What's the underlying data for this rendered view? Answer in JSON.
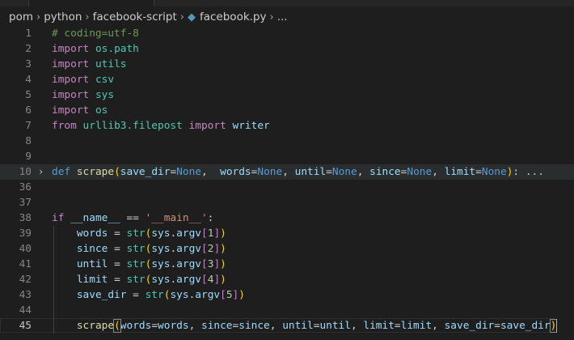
{
  "breadcrumb": {
    "items": [
      "pom",
      "python",
      "facebook-script"
    ],
    "file": "facebook.py",
    "more": "..."
  },
  "editor": {
    "lines": [
      {
        "num": "1",
        "tokens": [
          [
            "c",
            "# coding=utf-8"
          ]
        ]
      },
      {
        "num": "2",
        "tokens": [
          [
            "i",
            "import"
          ],
          [
            "e",
            " "
          ],
          [
            "m",
            "os.path"
          ]
        ]
      },
      {
        "num": "3",
        "tokens": [
          [
            "i",
            "import"
          ],
          [
            "e",
            " "
          ],
          [
            "m",
            "utils"
          ]
        ]
      },
      {
        "num": "4",
        "tokens": [
          [
            "i",
            "import"
          ],
          [
            "e",
            " "
          ],
          [
            "m",
            "csv"
          ]
        ]
      },
      {
        "num": "5",
        "tokens": [
          [
            "i",
            "import"
          ],
          [
            "e",
            " "
          ],
          [
            "m",
            "sys"
          ]
        ]
      },
      {
        "num": "6",
        "tokens": [
          [
            "i",
            "import"
          ],
          [
            "e",
            " "
          ],
          [
            "m",
            "os"
          ]
        ]
      },
      {
        "num": "7",
        "tokens": [
          [
            "i",
            "from"
          ],
          [
            "e",
            " "
          ],
          [
            "m",
            "urllib3.filepost"
          ],
          [
            "e",
            " "
          ],
          [
            "i",
            "import"
          ],
          [
            "e",
            " "
          ],
          [
            "v",
            "writer"
          ]
        ]
      },
      {
        "num": "8",
        "tokens": []
      },
      {
        "num": "9",
        "tokens": []
      },
      {
        "num": "10",
        "folded": true,
        "highlight": true,
        "tokens": [
          [
            "k",
            "def"
          ],
          [
            "e",
            " "
          ],
          [
            "f",
            "scrape"
          ],
          [
            "br",
            "("
          ],
          [
            "v",
            "save_dir"
          ],
          [
            "e",
            "="
          ],
          [
            "k",
            "None"
          ],
          [
            "e",
            ",  "
          ],
          [
            "v",
            "words"
          ],
          [
            "e",
            "="
          ],
          [
            "k",
            "None"
          ],
          [
            "e",
            ", "
          ],
          [
            "v",
            "until"
          ],
          [
            "e",
            "="
          ],
          [
            "k",
            "None"
          ],
          [
            "e",
            ", "
          ],
          [
            "v",
            "since"
          ],
          [
            "e",
            "="
          ],
          [
            "k",
            "None"
          ],
          [
            "e",
            ", "
          ],
          [
            "v",
            "limit"
          ],
          [
            "e",
            "="
          ],
          [
            "k",
            "None"
          ],
          [
            "br",
            ")"
          ],
          [
            "e",
            ":"
          ],
          [
            "ell",
            " ..."
          ]
        ]
      },
      {
        "num": "36",
        "tokens": []
      },
      {
        "num": "37",
        "tokens": []
      },
      {
        "num": "38",
        "tokens": [
          [
            "i",
            "if"
          ],
          [
            "e",
            " "
          ],
          [
            "v",
            "__name__"
          ],
          [
            "e",
            " == "
          ],
          [
            "s",
            "'__main__'"
          ],
          [
            "e",
            ":"
          ]
        ]
      },
      {
        "num": "39",
        "tokens": [
          [
            "e",
            "    "
          ],
          [
            "v",
            "words"
          ],
          [
            "e",
            " = "
          ],
          [
            "m",
            "str"
          ],
          [
            "br",
            "("
          ],
          [
            "v",
            "sys"
          ],
          [
            "e",
            "."
          ],
          [
            "v",
            "argv"
          ],
          [
            "bp",
            "["
          ],
          [
            "n",
            "1"
          ],
          [
            "bp",
            "]"
          ],
          [
            "br",
            ")"
          ]
        ]
      },
      {
        "num": "40",
        "tokens": [
          [
            "e",
            "    "
          ],
          [
            "v",
            "since"
          ],
          [
            "e",
            " = "
          ],
          [
            "m",
            "str"
          ],
          [
            "br",
            "("
          ],
          [
            "v",
            "sys"
          ],
          [
            "e",
            "."
          ],
          [
            "v",
            "argv"
          ],
          [
            "bp",
            "["
          ],
          [
            "n",
            "2"
          ],
          [
            "bp",
            "]"
          ],
          [
            "br",
            ")"
          ]
        ]
      },
      {
        "num": "41",
        "tokens": [
          [
            "e",
            "    "
          ],
          [
            "v",
            "until"
          ],
          [
            "e",
            " = "
          ],
          [
            "m",
            "str"
          ],
          [
            "br",
            "("
          ],
          [
            "v",
            "sys"
          ],
          [
            "e",
            "."
          ],
          [
            "v",
            "argv"
          ],
          [
            "bp",
            "["
          ],
          [
            "n",
            "3"
          ],
          [
            "bp",
            "]"
          ],
          [
            "br",
            ")"
          ]
        ]
      },
      {
        "num": "42",
        "tokens": [
          [
            "e",
            "    "
          ],
          [
            "v",
            "limit"
          ],
          [
            "e",
            " = "
          ],
          [
            "m",
            "str"
          ],
          [
            "br",
            "("
          ],
          [
            "v",
            "sys"
          ],
          [
            "e",
            "."
          ],
          [
            "v",
            "argv"
          ],
          [
            "bp",
            "["
          ],
          [
            "n",
            "4"
          ],
          [
            "bp",
            "]"
          ],
          [
            "br",
            ")"
          ]
        ]
      },
      {
        "num": "43",
        "tokens": [
          [
            "e",
            "    "
          ],
          [
            "v",
            "save_dir"
          ],
          [
            "e",
            " = "
          ],
          [
            "m",
            "str"
          ],
          [
            "br",
            "("
          ],
          [
            "v",
            "sys"
          ],
          [
            "e",
            "."
          ],
          [
            "v",
            "argv"
          ],
          [
            "bp",
            "["
          ],
          [
            "n",
            "5"
          ],
          [
            "bp",
            "]"
          ],
          [
            "br",
            ")"
          ]
        ]
      },
      {
        "num": "44",
        "tokens": []
      },
      {
        "num": "45",
        "current": true,
        "tokens": [
          [
            "e",
            "    "
          ],
          [
            "f",
            "scrape"
          ],
          [
            "br match",
            "("
          ],
          [
            "v",
            "words"
          ],
          [
            "e",
            "="
          ],
          [
            "v",
            "words"
          ],
          [
            "e",
            ", "
          ],
          [
            "v",
            "since"
          ],
          [
            "e",
            "="
          ],
          [
            "v",
            "since"
          ],
          [
            "e",
            ", "
          ],
          [
            "v",
            "until"
          ],
          [
            "e",
            "="
          ],
          [
            "v",
            "until"
          ],
          [
            "e",
            ", "
          ],
          [
            "v",
            "limit"
          ],
          [
            "e",
            "="
          ],
          [
            "v",
            "limit"
          ],
          [
            "e",
            ", "
          ],
          [
            "v",
            "save_dir"
          ],
          [
            "e",
            "="
          ],
          [
            "v",
            "save_dir"
          ],
          [
            "br match",
            ")"
          ]
        ]
      }
    ]
  },
  "colors": {
    "background": "#1e1e1e",
    "keyword": "#569cd6",
    "control": "#c586c0",
    "comment": "#6a9955",
    "function": "#dcdcaa",
    "type": "#4ec9b0",
    "variable": "#9cdcfe",
    "string": "#ce9178",
    "number": "#b5cea8"
  }
}
